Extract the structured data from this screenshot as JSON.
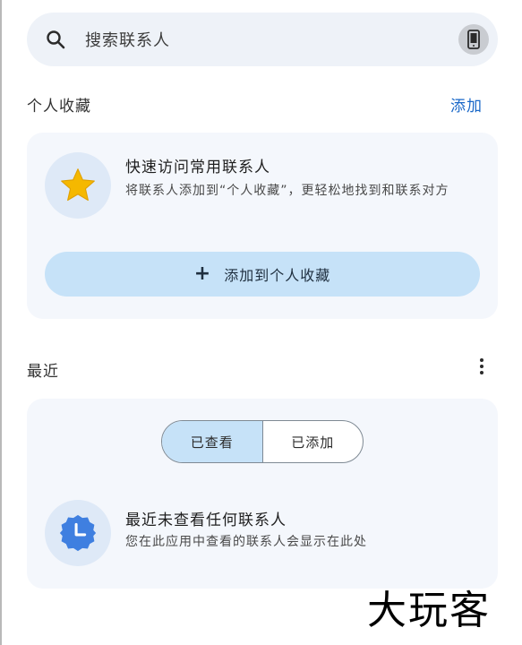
{
  "search": {
    "placeholder": "搜索联系人"
  },
  "favorites": {
    "section_title": "个人收藏",
    "add_link": "添加",
    "card_heading": "快速访问常用联系人",
    "card_body": "将联系人添加到“个人收藏”，更轻松地找到和联系对方",
    "add_button": "添加到个人收藏"
  },
  "recent": {
    "section_title": "最近",
    "tabs": [
      "已查看",
      "已添加"
    ],
    "selected_tab": "已查看",
    "empty_heading": "最近未查看任何联系人",
    "empty_body": "您在此应用中查看的联系人会显示在此处"
  },
  "watermark": "大玩客",
  "colors": {
    "accent": "#1a68c8",
    "star": "#f5b800",
    "clock_badge": "#3f7fe0",
    "tonal_button": "#c6e2f8",
    "card_bg": "#f4f7fc"
  }
}
